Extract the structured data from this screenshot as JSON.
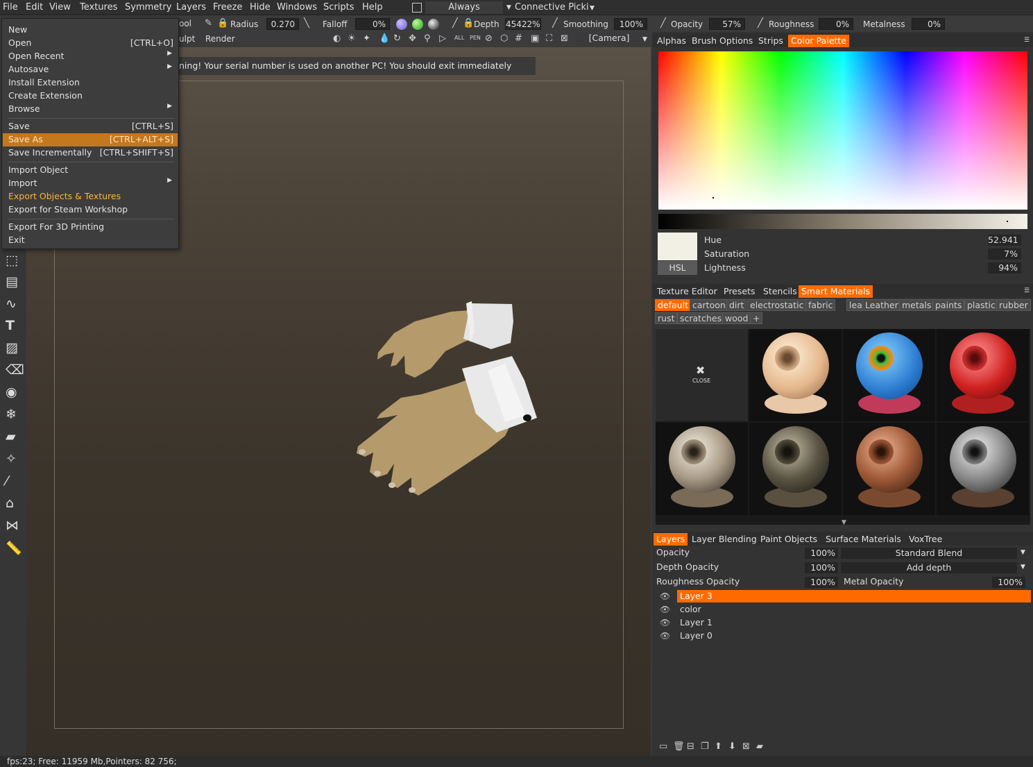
{
  "menubar": {
    "items": [
      "File",
      "Edit",
      "View",
      "Textures",
      "Symmetry",
      "Layers",
      "Freeze",
      "Hide",
      "Windows",
      "Scripts",
      "Help"
    ],
    "always": "Always",
    "connective": "Connective Picki"
  },
  "toolbar": {
    "radius_label": "Radius",
    "radius_value": "0.270",
    "falloff_label": "Falloff",
    "falloff_value": "0%",
    "depth_label": "Depth",
    "depth_value": "45422%",
    "smoothing_label": "Smoothing",
    "smoothing_value": "100%",
    "opacity_label": "Opacity",
    "opacity_value": "57%",
    "roughness_label": "Roughness",
    "roughness_value": "0%",
    "metalness_label": "Metalness",
    "metalness_value": "0%",
    "tool_partial": "ool",
    "sculpt_partial": "ulpt",
    "render": "Render",
    "camera": "[Camera]"
  },
  "warning": "ning! Your serial number is used on another PC! You should exit immediately",
  "file_menu": [
    {
      "label": "New",
      "shortcut": ""
    },
    {
      "label": "Open",
      "shortcut": "[CTRL+O]"
    },
    {
      "label": "Open Recent",
      "shortcut": ""
    },
    {
      "label": "Autosave",
      "shortcut": ""
    },
    {
      "label": "Install Extension",
      "shortcut": ""
    },
    {
      "label": "Create Extension",
      "shortcut": ""
    },
    {
      "label": "Browse",
      "shortcut": ""
    },
    {
      "label": "Save",
      "shortcut": "[CTRL+S]"
    },
    {
      "label": "Save As",
      "shortcut": "[CTRL+ALT+S]"
    },
    {
      "label": "Save Incrementally",
      "shortcut": "[CTRL+SHIFT+S]"
    },
    {
      "label": "Import Object",
      "shortcut": ""
    },
    {
      "label": "Import",
      "shortcut": ""
    },
    {
      "label": "Export Objects & Textures",
      "shortcut": ""
    },
    {
      "label": "Export for Steam Workshop",
      "shortcut": ""
    },
    {
      "label": "Export For 3D Printing",
      "shortcut": ""
    },
    {
      "label": "Exit",
      "shortcut": ""
    }
  ],
  "status": "fps:23;     Free: 11959 Mb,Pointers: 82 756;",
  "color_tabs": [
    "Alphas",
    "Brush Options",
    "Strips",
    "Color Palette"
  ],
  "hsl": {
    "mode": "HSL",
    "hue_label": "Hue",
    "hue": "52.941",
    "sat_label": "Saturation",
    "sat": "7%",
    "light_label": "Lightness",
    "light": "94%",
    "swatch_color": "#f2f0e4"
  },
  "material_tabs": [
    "Texture Editor",
    "Presets",
    "Stencils",
    "Smart Materials"
  ],
  "material_chips": [
    "default",
    "cartoon",
    "dirt",
    "electrostatic",
    "fabric",
    "leaks",
    "Leather",
    "metals",
    "paints",
    "plastic",
    "rubber",
    "rust",
    "scratches",
    "wood"
  ],
  "close_label": "CLOSE",
  "layer_tabs": [
    "Layers",
    "Layer Blending",
    "Paint Objects",
    "Surface Materials",
    "VoxTree"
  ],
  "layer_props": {
    "opacity_label": "Opacity",
    "opacity": "100%",
    "blend": "Standard Blend",
    "depth_label": "Depth Opacity",
    "depth": "100%",
    "depth_mode": "Add depth",
    "rough_label": "Roughness Opacity",
    "rough": "100%",
    "metal_label": "Metal Opacity",
    "metal": "100%"
  },
  "layers": [
    "Layer 3",
    "color",
    "Layer 1",
    "Layer 0"
  ],
  "accent": "#ff6a00"
}
